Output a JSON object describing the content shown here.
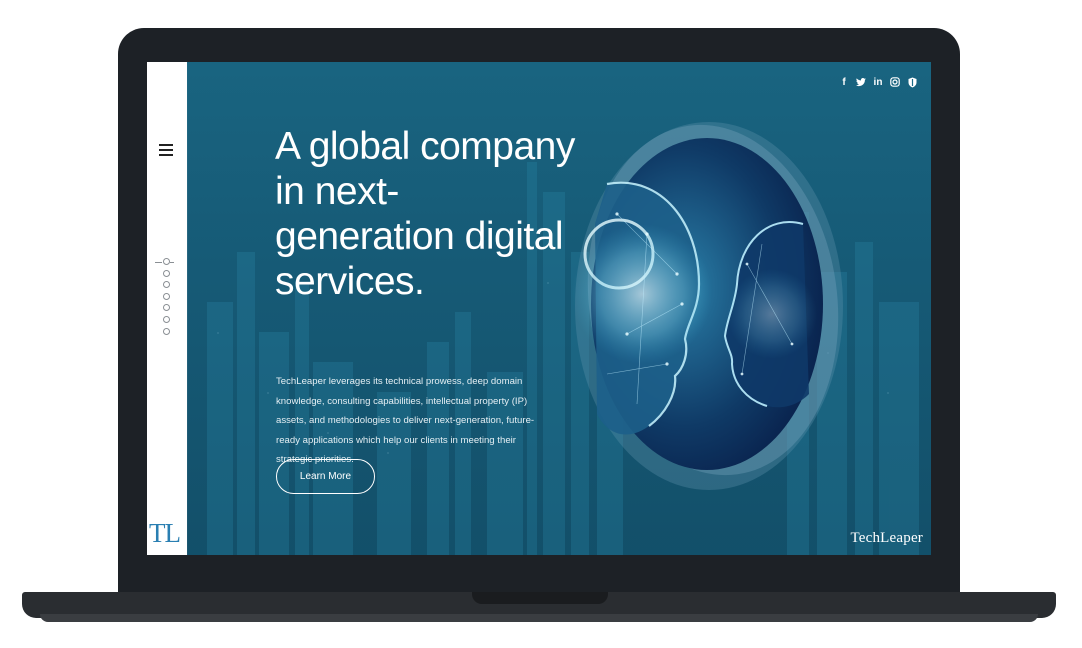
{
  "header": {
    "social_icons": [
      {
        "name": "facebook-icon",
        "glyph": "f"
      },
      {
        "name": "twitter-icon",
        "glyph": "🐦"
      },
      {
        "name": "linkedin-icon",
        "glyph": "in"
      },
      {
        "name": "instagram-icon",
        "glyph": "◎"
      },
      {
        "name": "shield-icon",
        "glyph": "⛉"
      }
    ]
  },
  "sidebar": {
    "logo_text": "TL",
    "menu_icon": "hamburger-icon",
    "section_count": 7,
    "active_section": 1
  },
  "hero": {
    "headline": "A global company in next-generation digital services.",
    "description": "TechLeaper leverages its technical prowess, deep domain knowledge, consulting capabilities, intellectual property (IP) assets, and methodologies to deliver next-generation, future-ready applications which help our clients in meeting their strategic priorities.",
    "cta_label": "Learn More"
  },
  "footer": {
    "brand": "TechLeaper"
  },
  "colors": {
    "hero_background": "#1b6a86",
    "frame": "#1d2126",
    "logo_blue": "#2a7fb2"
  }
}
